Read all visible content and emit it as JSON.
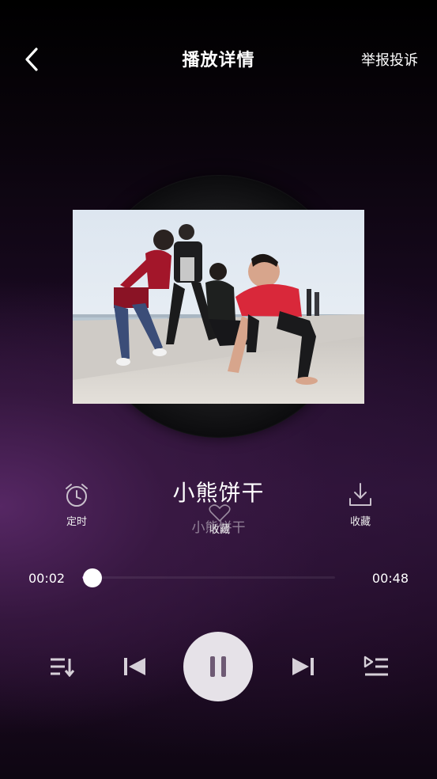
{
  "header": {
    "back_icon": "chevron-left-icon",
    "title": "播放详情",
    "report_label": "举报投诉"
  },
  "song": {
    "title": "小熊饼干",
    "artist": "小熊饼干"
  },
  "actions": {
    "timer_label": "定时",
    "timer_icon": "alarm-clock-icon",
    "favorite_label": "收藏",
    "favorite_icon": "heart-icon",
    "download_label": "收藏",
    "download_icon": "download-icon"
  },
  "progress": {
    "current_time": "00:02",
    "total_time": "00:48",
    "fraction": 0.04
  },
  "controls": {
    "playlist_icon": "playlist-order-icon",
    "previous_icon": "skip-previous-icon",
    "play_pause_icon": "pause-icon",
    "next_icon": "skip-next-icon",
    "queue_icon": "play-queue-icon"
  },
  "colors": {
    "accent": "#b070c8",
    "play_button_bg": "#e6e2e8"
  }
}
